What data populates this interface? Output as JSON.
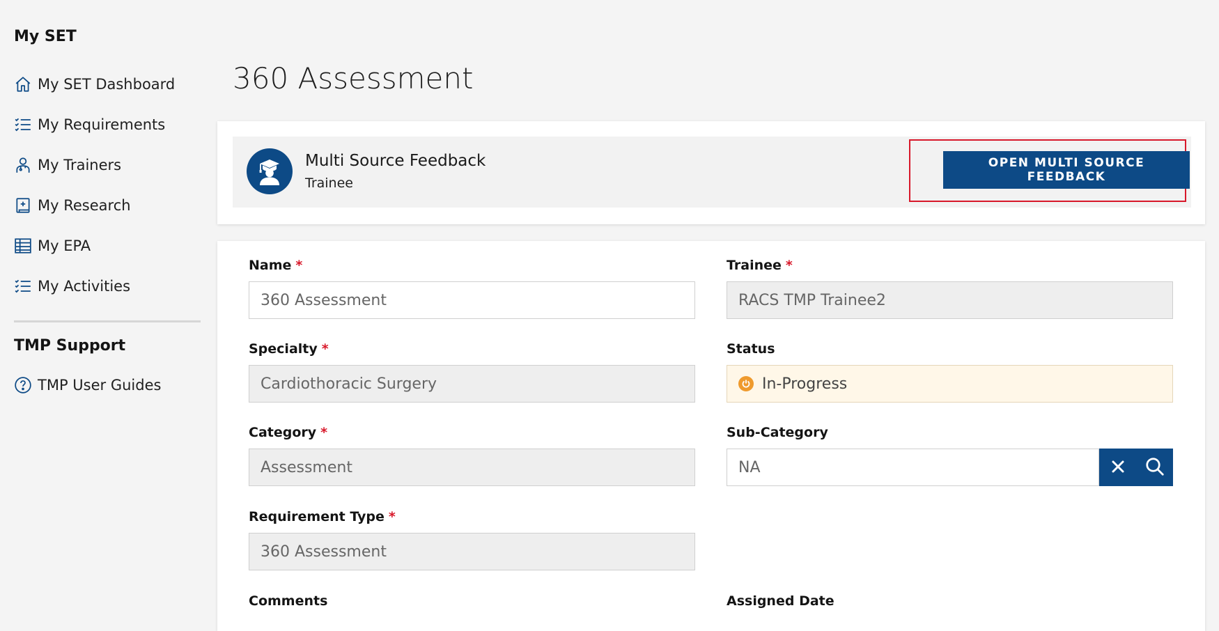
{
  "sidebar": {
    "section1_title": "My SET",
    "items": [
      {
        "label": "My SET Dashboard",
        "icon": "home-icon"
      },
      {
        "label": "My Requirements",
        "icon": "checklist-icon"
      },
      {
        "label": "My Trainers",
        "icon": "person-icon"
      },
      {
        "label": "My Research",
        "icon": "book-plus-icon"
      },
      {
        "label": "My EPA",
        "icon": "table-icon"
      },
      {
        "label": "My Activities",
        "icon": "checklist-icon"
      }
    ],
    "section2_title": "TMP Support",
    "support_items": [
      {
        "label": "TMP User Guides",
        "icon": "help-circle-icon"
      }
    ]
  },
  "page": {
    "title": "360 Assessment"
  },
  "feedback": {
    "title": "Multi Source Feedback",
    "subtitle": "Trainee",
    "open_button_label": "OPEN MULTI SOURCE FEEDBACK",
    "avatar_icon": "graduate-icon"
  },
  "form": {
    "name": {
      "label": "Name",
      "value": "360 Assessment",
      "required_mark": "*"
    },
    "trainee": {
      "label": "Trainee",
      "value": "RACS TMP Trainee2",
      "required_mark": "*"
    },
    "specialty": {
      "label": "Specialty",
      "value": "Cardiothoracic Surgery",
      "required_mark": "*"
    },
    "status": {
      "label": "Status",
      "value": "In-Progress"
    },
    "category": {
      "label": "Category",
      "value": "Assessment",
      "required_mark": "*"
    },
    "subcategory": {
      "label": "Sub-Category",
      "value": "NA"
    },
    "requirement_type": {
      "label": "Requirement Type",
      "value": "360 Assessment",
      "required_mark": "*"
    },
    "comments": {
      "label": "Comments"
    },
    "assigned_date": {
      "label": "Assigned Date"
    }
  },
  "colors": {
    "primary": "#0d4a86",
    "required": "#d8182a",
    "highlight": "#d8182a",
    "status_bg": "#fff7e8",
    "status_icon": "#ef9a2d"
  }
}
